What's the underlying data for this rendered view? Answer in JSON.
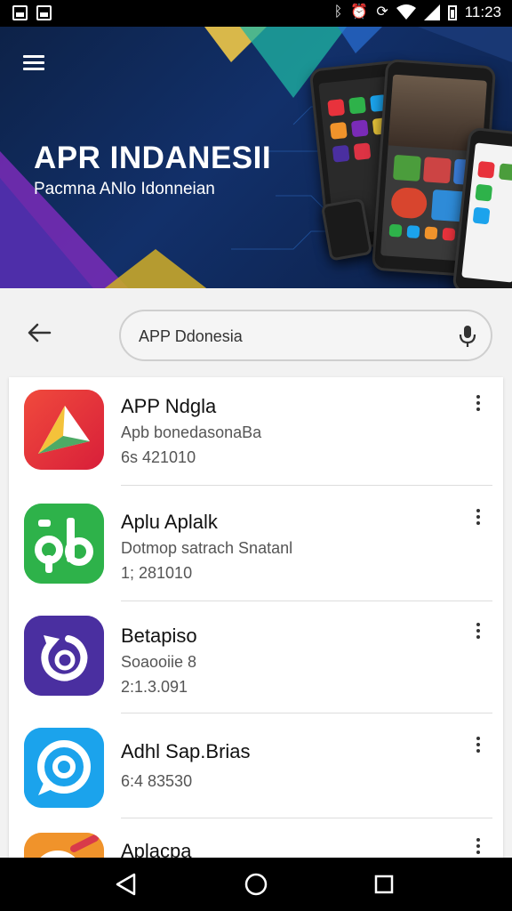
{
  "status_bar": {
    "time": "11:23"
  },
  "banner": {
    "title": "APR INDANESII",
    "subtitle": "Pacmna ANlo Idonneian"
  },
  "search": {
    "value": "APP Ddonesia"
  },
  "apps": [
    {
      "name": "APP Ndgla",
      "description": "Apb bonedasonaBa",
      "number": "6s 421010",
      "icon_color": "#e8323c",
      "icon": "play-arrow-icon"
    },
    {
      "name": "Aplu Aplalk",
      "description": "Dotmop satrach Snatanl",
      "number": "1; 281010",
      "icon_color": "#2eb24a",
      "icon": "pb-logo-icon"
    },
    {
      "name": "Betapiso",
      "description": "Soaooiie 8",
      "number": "2:1.3.091",
      "icon_color": "#4a2fa0",
      "icon": "refresh-icon"
    },
    {
      "name": "Adhl Sap.Brias",
      "description": "",
      "number": "6:4 83530",
      "icon_color": "#1ba3ec",
      "icon": "chat-bubble-icon"
    },
    {
      "name": "Aplacpa",
      "description": "",
      "number": "",
      "icon_color": "#f0932b",
      "icon": "brush-icon"
    }
  ]
}
